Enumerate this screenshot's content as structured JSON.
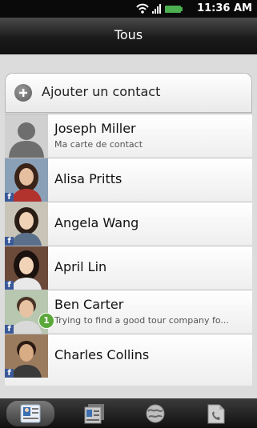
{
  "status_bar": {
    "time": "11:36 AM",
    "icons": [
      "wifi-icon",
      "signal-icon",
      "battery-icon"
    ]
  },
  "header": {
    "title": "Tous"
  },
  "add_contact": {
    "label": "Ajouter un contact",
    "icon": "plus-icon"
  },
  "contacts": [
    {
      "name": "Joseph Miller",
      "subtitle": "Ma carte de contact",
      "facebook": false
    },
    {
      "name": "Alisa Pritts",
      "subtitle": "",
      "facebook": true
    },
    {
      "name": "Angela Wang",
      "subtitle": "",
      "facebook": true
    },
    {
      "name": "April  Lin",
      "subtitle": "",
      "facebook": true
    },
    {
      "name": "Ben  Carter",
      "subtitle": "Trying to find a good tour company fo...",
      "facebook": true,
      "badge": "1"
    },
    {
      "name": "Charles  Collins",
      "subtitle": "",
      "facebook": true
    }
  ],
  "tabs": [
    {
      "icon": "contacts-tab-icon",
      "active": true
    },
    {
      "icon": "groups-tab-icon",
      "active": false
    },
    {
      "icon": "online-directory-tab-icon",
      "active": false
    },
    {
      "icon": "call-history-tab-icon",
      "active": false
    }
  ],
  "colors": {
    "facebook": "#3b5998",
    "badge": "#5aa83a",
    "battery": "#4caf50"
  }
}
